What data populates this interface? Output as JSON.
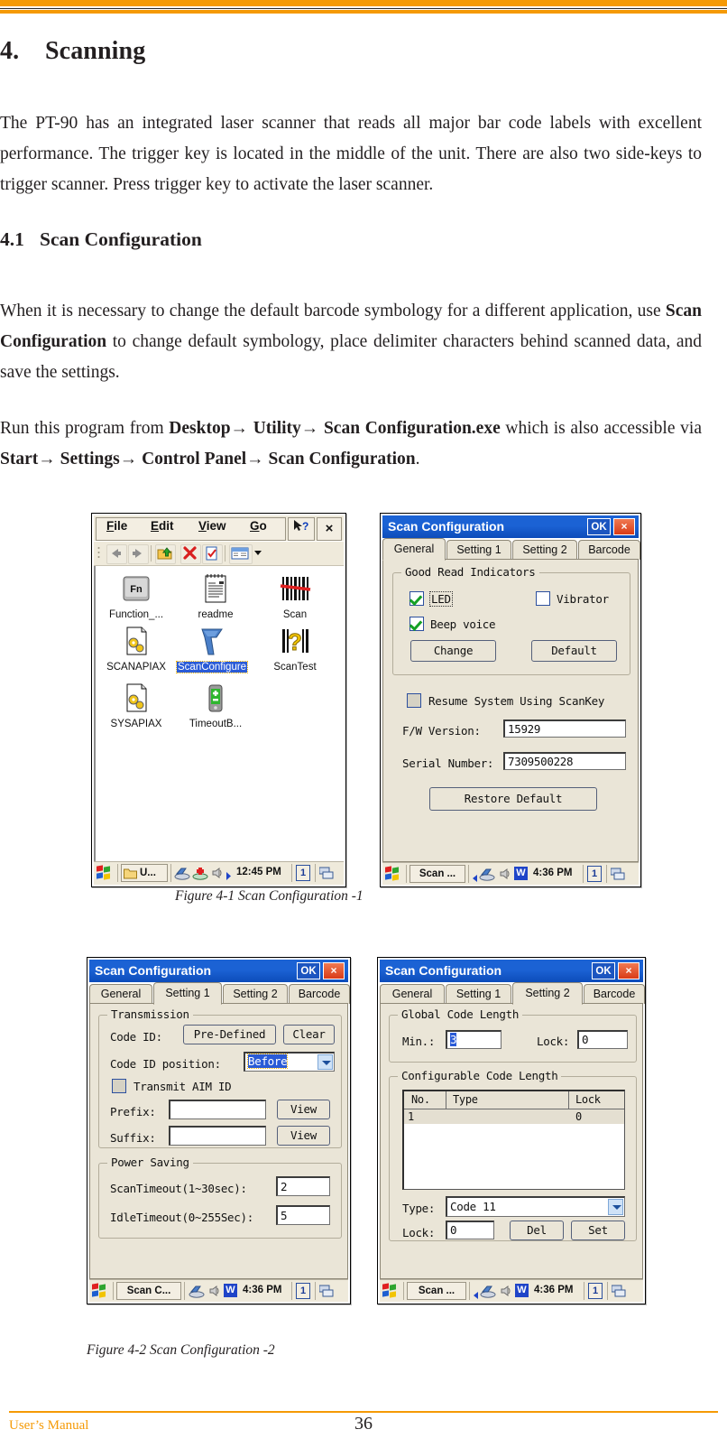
{
  "document": {
    "heading": {
      "number": "4.",
      "title": "Scanning"
    },
    "intro": "The PT-90 has an integrated laser scanner that reads all major bar code labels with excellent performance. The trigger key is located in the middle of the unit. There are also two side-keys to trigger scanner. Press trigger key to activate the laser scanner.",
    "subheading": {
      "number": "4.1",
      "title": "Scan Configuration"
    },
    "para2_a": "When it is necessary to change the default barcode symbology for a different application, use ",
    "para2_bold": "Scan Configuration",
    "para2_b": " to change default symbology, place delimiter characters behind scanned data, and save the settings.",
    "para3_a": "Run this program from ",
    "para3_bold1": "Desktop→ Utility→ Scan Configuration.exe",
    "para3_b": " which is also accessible via ",
    "para3_bold2": "Start→ Settings→ Control Panel→ Scan Configuration",
    "para3_c": ".",
    "caption1": "Figure 4-1 Scan Configuration  -1",
    "caption2": "Figure 4-2 Scan Configuration -2",
    "footer_left": "User’s Manual",
    "footer_page": "36",
    "accent_color": "#f59a06"
  },
  "explorer": {
    "menu": [
      {
        "label": "File",
        "mnemonic": "F"
      },
      {
        "label": "Edit",
        "mnemonic": "E"
      },
      {
        "label": "View",
        "mnemonic": "V"
      },
      {
        "label": "Go",
        "mnemonic": "G"
      }
    ],
    "help_label": "?",
    "close_label": "×",
    "toolbar_icons": [
      "back-icon",
      "forward-icon",
      "up-folder-icon",
      "delete-icon",
      "properties-icon",
      "view-mode-icon",
      "view-dropdown-icon"
    ],
    "files": [
      {
        "name": "Function_...",
        "icon": "fn-key-icon",
        "selected": false
      },
      {
        "name": "readme",
        "icon": "notepad-icon",
        "selected": false
      },
      {
        "name": "Scan",
        "icon": "barcode-icon",
        "selected": false
      },
      {
        "name": "SCANAPIAX",
        "icon": "dll-gears-icon",
        "selected": false
      },
      {
        "name": "ScanConfigure",
        "icon": "scanner-gun-icon",
        "selected": true
      },
      {
        "name": "ScanTest",
        "icon": "barcode-question-icon",
        "selected": false
      },
      {
        "name": "SYSAPIAX",
        "icon": "dll-gears-icon",
        "selected": false
      },
      {
        "name": "TimeoutB...",
        "icon": "battery-icon",
        "selected": false
      }
    ],
    "taskbar": {
      "start_icon": "windows-start-icon",
      "task_label": "U...",
      "task_icon": "folder-icon",
      "tray_icons": [
        "network-icon",
        "activesync-icon",
        "speaker-icon",
        "arrow-icon"
      ],
      "clock": "12:45 PM",
      "num_badge": "1",
      "desktop_icon": "show-desktop-icon"
    }
  },
  "dialog_general": {
    "title": "Scan Configuration",
    "ok_label": "OK",
    "close_label": "×",
    "tabs": [
      {
        "label": "General",
        "active": true
      },
      {
        "label": "Setting 1",
        "active": false
      },
      {
        "label": "Setting 2",
        "active": false
      },
      {
        "label": "Barcode",
        "active": false
      }
    ],
    "group_label": "Good Read Indicators",
    "checkboxes": [
      {
        "label": "LED",
        "checked": true,
        "focused": true
      },
      {
        "label": "Vibrator",
        "checked": false,
        "focused": false
      },
      {
        "label": "Beep voice",
        "checked": true,
        "focused": false
      }
    ],
    "buttons": [
      "Change",
      "Default"
    ],
    "resume_label": "Resume System Using ScanKey",
    "resume_checked": false,
    "fields": [
      {
        "label": "F/W Version:",
        "value": "15929"
      },
      {
        "label": "Serial Number:",
        "value": "7309500228"
      }
    ],
    "restore_label": "Restore Default",
    "taskbar": {
      "task_label": "Scan ...",
      "clock": "4:36 PM",
      "num_badge": "1",
      "word_badge": "W"
    }
  },
  "dialog_setting1": {
    "title": "Scan Configuration",
    "ok_label": "OK",
    "close_label": "×",
    "tabs": [
      {
        "label": "General",
        "active": false
      },
      {
        "label": "Setting 1",
        "active": true
      },
      {
        "label": "Setting 2",
        "active": false
      },
      {
        "label": "Barcode",
        "active": false
      }
    ],
    "transmission_label": "Transmission",
    "code_id_label": "Code ID:",
    "code_id_button": "Pre-Defined",
    "clear_button": "Clear",
    "code_id_pos_label": "Code ID position:",
    "code_id_pos_value": "Before",
    "transmit_aim_label": "Transmit AIM ID",
    "transmit_aim_checked": false,
    "prefix_label": "Prefix:",
    "prefix_value": "",
    "prefix_button": "View",
    "suffix_label": "Suffix:",
    "suffix_value": "",
    "suffix_button": "View",
    "power_saving_label": "Power Saving",
    "scan_timeout_label": "ScanTimeout(1~30sec):",
    "scan_timeout_value": "2",
    "idle_timeout_label": "IdleTimeout(0~255Sec):",
    "idle_timeout_value": "5",
    "taskbar": {
      "task_label": "Scan C...",
      "clock": "4:36 PM",
      "num_badge": "1",
      "word_badge": "W"
    }
  },
  "dialog_setting2": {
    "title": "Scan Configuration",
    "ok_label": "OK",
    "close_label": "×",
    "tabs": [
      {
        "label": "General",
        "active": false
      },
      {
        "label": "Setting 1",
        "active": false
      },
      {
        "label": "Setting 2",
        "active": true
      },
      {
        "label": "Barcode",
        "active": false
      }
    ],
    "global_label": "Global Code Length",
    "min_label": "Min.:",
    "min_value": "3",
    "lock_label": "Lock:",
    "lock_value": "0",
    "configurable_label": "Configurable Code Length",
    "table": {
      "columns": [
        "No.",
        "Type",
        "Lock"
      ],
      "rows": [
        {
          "no": "1",
          "type": "",
          "lock": "0"
        }
      ]
    },
    "type_label": "Type:",
    "type_value": "Code 11",
    "lock2_label": "Lock:",
    "lock2_value": "0",
    "del_button": "Del",
    "set_button": "Set",
    "taskbar": {
      "task_label": "Scan ...",
      "clock": "4:36 PM",
      "num_badge": "1",
      "word_badge": "W"
    }
  }
}
